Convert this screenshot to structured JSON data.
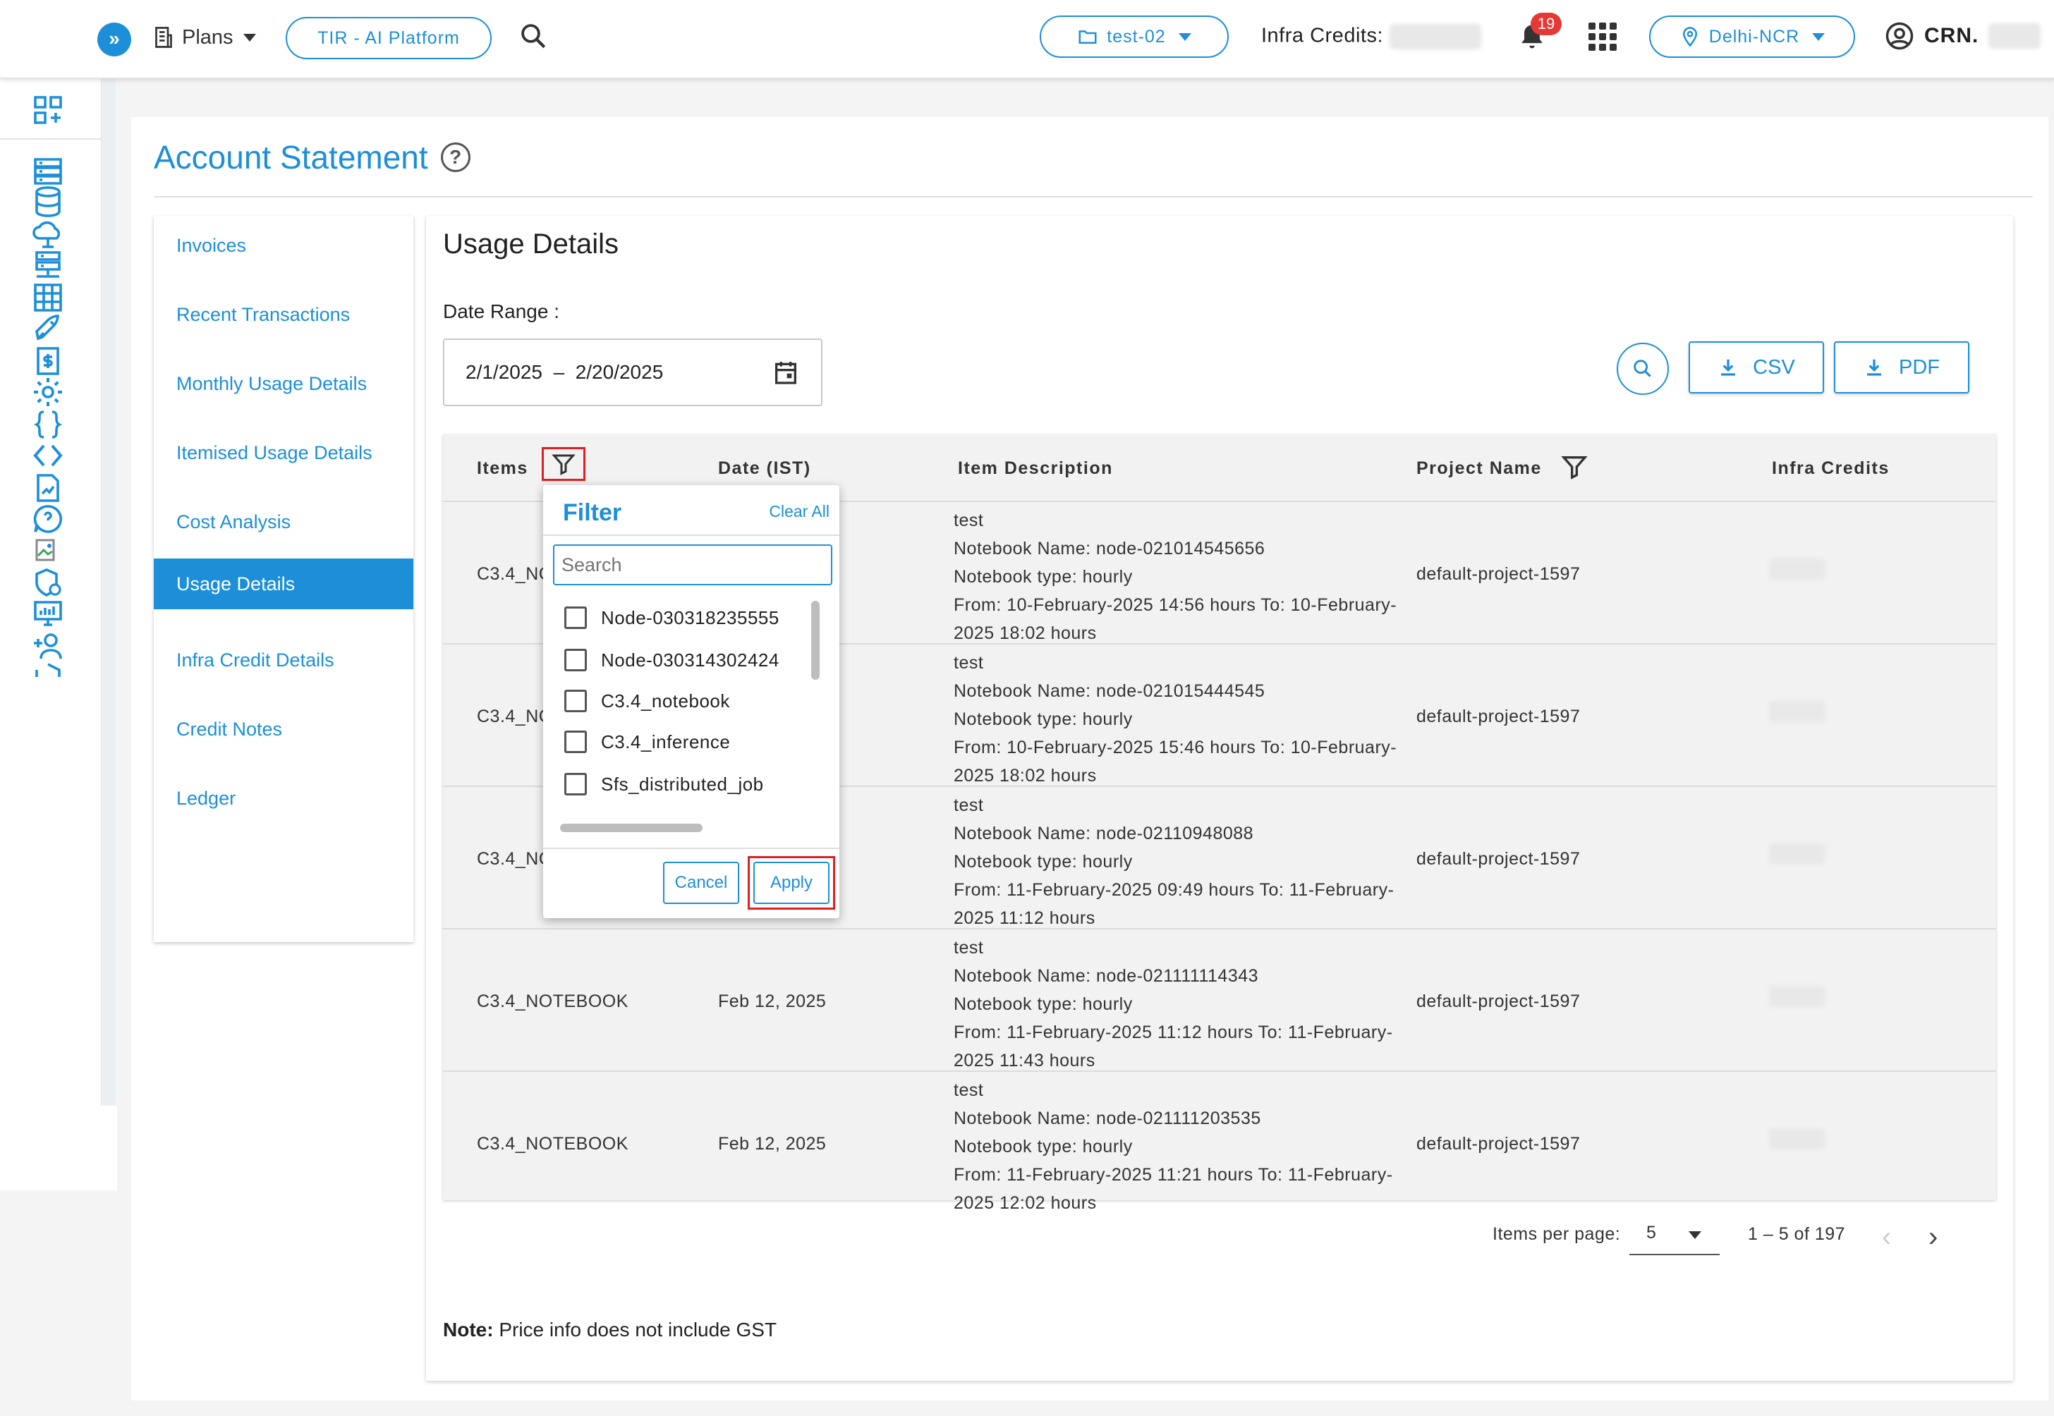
{
  "topbar": {
    "plans_label": "Plans",
    "platform_label": "TIR - AI Platform",
    "project_label": "test-02",
    "infra_credits_label": "Infra Credits:",
    "notification_count": "19",
    "region_label": "Delhi-NCR",
    "crn_label": "CRN."
  },
  "page": {
    "title": "Account Statement"
  },
  "sidenav": {
    "items": [
      {
        "label": "Invoices"
      },
      {
        "label": "Recent Transactions"
      },
      {
        "label": "Monthly Usage Details"
      },
      {
        "label": "Itemised Usage Details"
      },
      {
        "label": "Cost Analysis"
      },
      {
        "label": "Usage Details",
        "active": true
      },
      {
        "label": "Infra Credit Details"
      },
      {
        "label": "Credit Notes"
      },
      {
        "label": "Ledger"
      }
    ]
  },
  "content": {
    "title": "Usage Details",
    "date_range_label": "Date Range :",
    "date_start": "2/1/2025",
    "date_sep": "–",
    "date_end": "2/20/2025",
    "csv_label": "CSV",
    "pdf_label": "PDF"
  },
  "table": {
    "headers": {
      "items": "Items",
      "date": "Date (IST)",
      "description": "Item Description",
      "project": "Project Name",
      "credits": "Infra Credits"
    },
    "rows": [
      {
        "item": "C3.4_NC",
        "date": "",
        "desc": [
          "test",
          "Notebook Name: node-021014545656",
          "Notebook type: hourly",
          "From: 10-February-2025 14:56 hours To: 10-February-",
          "2025 18:02 hours"
        ],
        "project": "default-project-1597"
      },
      {
        "item": "C3.4_NC",
        "date": "",
        "desc": [
          "test",
          "Notebook Name: node-021015444545",
          "Notebook type: hourly",
          "From: 10-February-2025 15:46 hours To: 10-February-",
          "2025 18:02 hours"
        ],
        "project": "default-project-1597"
      },
      {
        "item": "C3.4_NC",
        "date": "",
        "desc": [
          "test",
          "Notebook Name: node-02110948088",
          "Notebook type: hourly",
          "From: 11-February-2025 09:49 hours To: 11-February-",
          "2025 11:12 hours"
        ],
        "project": "default-project-1597"
      },
      {
        "item": "C3.4_NOTEBOOK",
        "date": "Feb 12, 2025",
        "desc": [
          "test",
          "Notebook Name: node-021111114343",
          "Notebook type: hourly",
          "From: 11-February-2025 11:12 hours To: 11-February-",
          "2025 11:43 hours"
        ],
        "project": "default-project-1597"
      },
      {
        "item": "C3.4_NOTEBOOK",
        "date": "Feb 12, 2025",
        "desc": [
          "test",
          "Notebook Name: node-021111203535",
          "Notebook type: hourly",
          "From: 11-February-2025 11:21 hours To: 11-February-",
          "2025 12:02 hours"
        ],
        "project": "default-project-1597"
      }
    ]
  },
  "pagination": {
    "items_per_page_label": "Items per page:",
    "page_size": "5",
    "range_label": "1 – 5 of 197"
  },
  "note": {
    "label": "Note:",
    "text": " Price info does not include GST"
  },
  "filter_popup": {
    "title": "Filter",
    "clear_all": "Clear All",
    "search_placeholder": "Search",
    "options": [
      "Node-030318235555",
      "Node-030314302424",
      "C3.4_notebook",
      "C3.4_inference",
      "Sfs_distributed_job"
    ],
    "cancel_label": "Cancel",
    "apply_label": "Apply"
  },
  "colors": {
    "accent": "#1c8fd8",
    "highlight": "#e02020",
    "badge": "#e53935"
  }
}
